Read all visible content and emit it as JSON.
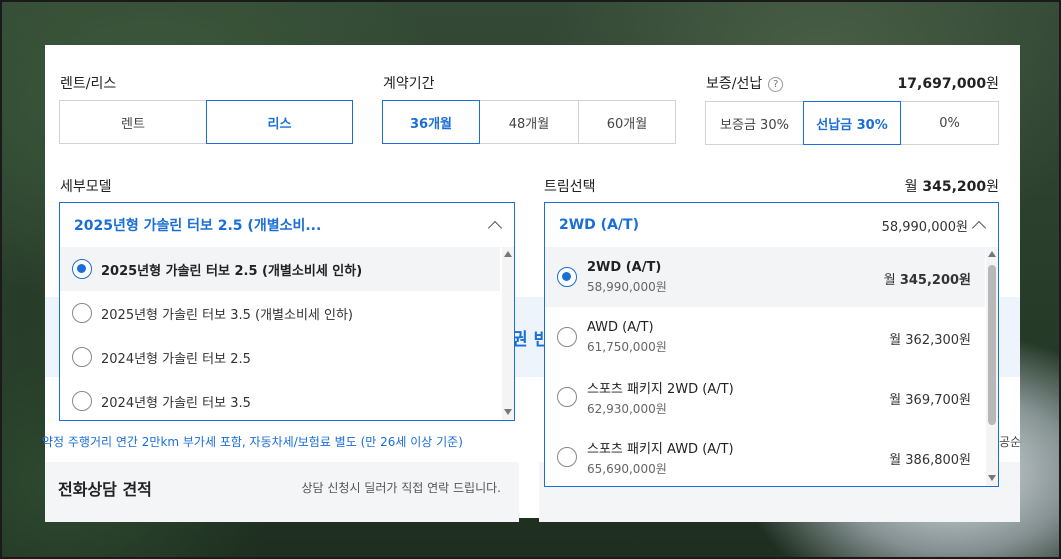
{
  "rent_lease": {
    "label": "렌트/리스",
    "options": [
      "렌트",
      "리스"
    ],
    "selected": "리스"
  },
  "contract_period": {
    "label": "계약기간",
    "options": [
      "36개월",
      "48개월",
      "60개월"
    ],
    "selected": "36개월"
  },
  "deposit": {
    "label": "보증/선납",
    "help": "?",
    "amount": "17,697,000",
    "unit": "원",
    "options": [
      "보증금 30%",
      "선납금 30%",
      "0%"
    ],
    "selected": "선납금 30%"
  },
  "sub_model": {
    "label": "세부모델",
    "selected_display": "2025년형 가솔린 터보 2.5 (개별소비...",
    "options": [
      "2025년형 가솔린 터보 2.5 (개별소비세 인하)",
      "2025년형 가솔린 터보 3.5 (개별소비세 인하)",
      "2024년형 가솔린 터보 2.5",
      "2024년형 가솔린 터보 3.5"
    ]
  },
  "trim": {
    "label": "트림선택",
    "monthly_prefix": "월",
    "monthly_amount": "345,200",
    "unit": "원",
    "selected_display": "2WD (A/T)",
    "selected_price": "58,990,000원",
    "options": [
      {
        "name": "2WD (A/T)",
        "price": "58,990,000원",
        "month_prefix": "월",
        "month_amount": "345,200원"
      },
      {
        "name": "AWD (A/T)",
        "price": "61,750,000원",
        "month_prefix": "월",
        "month_amount": "362,300원"
      },
      {
        "name": "스포츠 패키지 2WD (A/T)",
        "price": "62,930,000원",
        "month_prefix": "월",
        "month_amount": "369,700원"
      },
      {
        "name": "스포츠 패키지 AWD (A/T)",
        "price": "65,690,000원",
        "month_prefix": "월",
        "month_amount": "386,800원"
      }
    ]
  },
  "behind": {
    "partial_text": "권 빈",
    "note": "약정 주행거리 연간 2만km 부가세 포함, 자동차세/보험료 별도 (만 26세 이상 기준)",
    "right_cut": "공순",
    "phone_title": "전화상담 견적",
    "phone_desc": "상담 신청시 딜러가 직접 연락 드립니다."
  },
  "colors": {
    "accent": "#1a6ed8",
    "border": "#cfd3d8"
  }
}
